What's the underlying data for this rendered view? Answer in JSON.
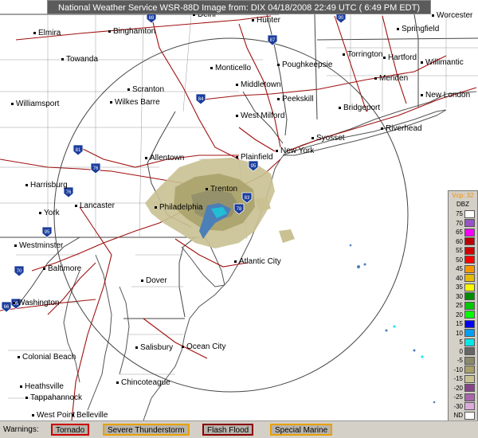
{
  "header": {
    "title": "National Weather Service WSR-88D Image  from: DIX 04/18/2008  22:49 UTC ( 6:49 PM EDT)"
  },
  "cities": [
    {
      "name": "Elmira"
    },
    {
      "name": "Binghamton"
    },
    {
      "name": "Delhi"
    },
    {
      "name": "Hunter"
    },
    {
      "name": "Worcester"
    },
    {
      "name": "Springfield"
    },
    {
      "name": "Towanda"
    },
    {
      "name": "Monticello"
    },
    {
      "name": "Poughkeepsie"
    },
    {
      "name": "Torrington"
    },
    {
      "name": "Hartford"
    },
    {
      "name": "Willimantic"
    },
    {
      "name": "Middletown"
    },
    {
      "name": "Meriden"
    },
    {
      "name": "Scranton"
    },
    {
      "name": "Wilkes Barre"
    },
    {
      "name": "Peekskill"
    },
    {
      "name": "New London"
    },
    {
      "name": "Williamsport"
    },
    {
      "name": "Bridgeport"
    },
    {
      "name": "West Milford"
    },
    {
      "name": "Riverhead"
    },
    {
      "name": "Syosset"
    },
    {
      "name": "New York"
    },
    {
      "name": "Allentown"
    },
    {
      "name": "Plainfield"
    },
    {
      "name": "Harrisburg"
    },
    {
      "name": "Trenton"
    },
    {
      "name": "Lancaster"
    },
    {
      "name": "Philadelphia"
    },
    {
      "name": "York"
    },
    {
      "name": "Westminster"
    },
    {
      "name": "Atlantic City"
    },
    {
      "name": "Baltimore"
    },
    {
      "name": "Dover"
    },
    {
      "name": "Washington"
    },
    {
      "name": "Salisbury"
    },
    {
      "name": "Ocean City"
    },
    {
      "name": "Colonial Beach"
    },
    {
      "name": "Chincoteague"
    },
    {
      "name": "Heathsville"
    },
    {
      "name": "Tappahannock"
    },
    {
      "name": "West Point"
    },
    {
      "name": "Belleville"
    }
  ],
  "highways": [
    "88",
    "87",
    "90",
    "84",
    "81",
    "76",
    "76",
    "78",
    "95",
    "83",
    "70",
    "95",
    "66",
    "95"
  ],
  "legend": {
    "header": "Vcp: 32",
    "unit": "DBZ",
    "levels": [
      {
        "label": "75",
        "color": "#ffffff"
      },
      {
        "label": "70",
        "color": "#9854c6"
      },
      {
        "label": "65",
        "color": "#f800fd"
      },
      {
        "label": "60",
        "color": "#bc0000"
      },
      {
        "label": "55",
        "color": "#d40000"
      },
      {
        "label": "50",
        "color": "#fd0000"
      },
      {
        "label": "45",
        "color": "#fd9500"
      },
      {
        "label": "40",
        "color": "#e5bc00"
      },
      {
        "label": "35",
        "color": "#fdf802"
      },
      {
        "label": "30",
        "color": "#008e00"
      },
      {
        "label": "25",
        "color": "#01c801"
      },
      {
        "label": "20",
        "color": "#02fd02"
      },
      {
        "label": "15",
        "color": "#0300f4"
      },
      {
        "label": "10",
        "color": "#019ff4"
      },
      {
        "label": "5",
        "color": "#04e9e7"
      },
      {
        "label": "0",
        "color": "#666666"
      },
      {
        "label": "-5",
        "color": "#8a8a6a"
      },
      {
        "label": "-10",
        "color": "#a8a068"
      },
      {
        "label": "-15",
        "color": "#c9c192"
      },
      {
        "label": "-20",
        "color": "#884488"
      },
      {
        "label": "-25",
        "color": "#aa66aa"
      },
      {
        "label": "-30",
        "color": "#ddaadd"
      },
      {
        "label": "ND",
        "color": "#ffffff"
      }
    ]
  },
  "warnings": {
    "label": "Warnings:",
    "buttons": [
      {
        "label": "Tornado",
        "border": "#cc0000"
      },
      {
        "label": "Severe Thunderstorm",
        "border": "#e8a000"
      },
      {
        "label": "Flash Flood",
        "border": "#8b0000"
      },
      {
        "label": "Special Marine",
        "border": "#e8a000"
      }
    ]
  }
}
